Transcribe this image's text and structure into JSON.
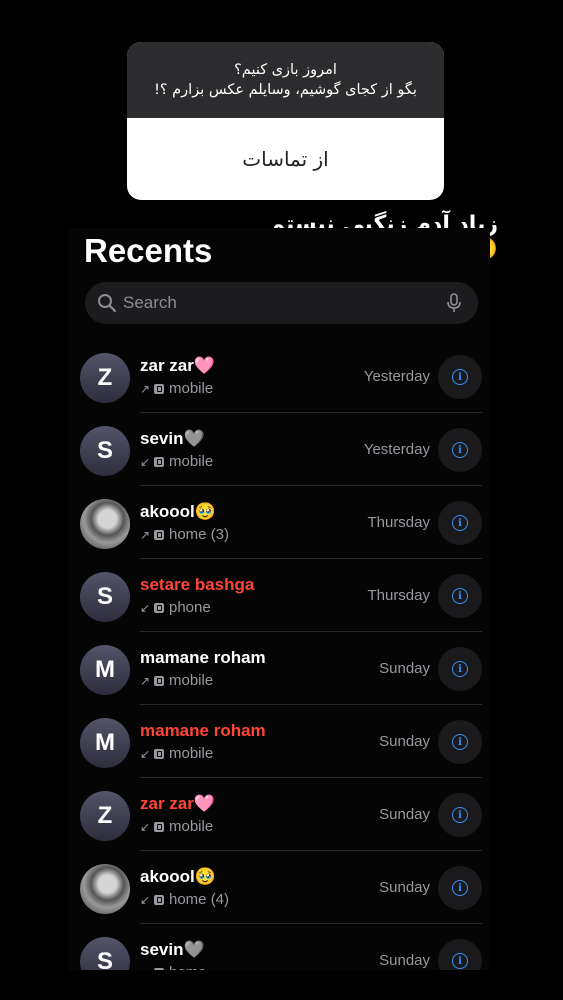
{
  "story": {
    "question_line1": "امروز بازی کنیم؟",
    "question_line2": "بگو از کجای گوشیم، وسایلم عکس بزارم ؟!",
    "answer": "از تماسات",
    "caption": "زیاد آدم زنگیی نیستم🥲"
  },
  "recents": {
    "title": "Recents",
    "search_placeholder": "Search",
    "calls": [
      {
        "initial": "Z",
        "name": "zar zar🩷",
        "type": "mobile",
        "direction": "↗",
        "date": "Yesterday",
        "missed": false,
        "photo": false
      },
      {
        "initial": "S",
        "name": "sevin🩶",
        "type": "mobile",
        "direction": "↙",
        "date": "Yesterday",
        "missed": false,
        "photo": false
      },
      {
        "initial": "",
        "name": "akoool🥹",
        "type": "home (3)",
        "direction": "↗",
        "date": "Thursday",
        "missed": false,
        "photo": true
      },
      {
        "initial": "S",
        "name": "setare bashga",
        "type": "phone",
        "direction": "↙",
        "date": "Thursday",
        "missed": true,
        "photo": false
      },
      {
        "initial": "M",
        "name": "mamane roham",
        "type": "mobile",
        "direction": "↗",
        "date": "Sunday",
        "missed": false,
        "photo": false
      },
      {
        "initial": "M",
        "name": "mamane roham",
        "type": "mobile",
        "direction": "↙",
        "date": "Sunday",
        "missed": true,
        "photo": false
      },
      {
        "initial": "Z",
        "name": "zar zar🩷",
        "type": "mobile",
        "direction": "↙",
        "date": "Sunday",
        "missed": true,
        "photo": false
      },
      {
        "initial": "",
        "name": "akoool🥹",
        "type": "home (4)",
        "direction": "↙",
        "date": "Sunday",
        "missed": false,
        "photo": true
      },
      {
        "initial": "S",
        "name": "sevin🩶",
        "type": "home",
        "direction": "↙",
        "date": "Sunday",
        "missed": false,
        "photo": false
      }
    ]
  },
  "colors": {
    "missed": "#ff453a",
    "accent": "#3b8df5",
    "secondary_text": "#98989f"
  }
}
